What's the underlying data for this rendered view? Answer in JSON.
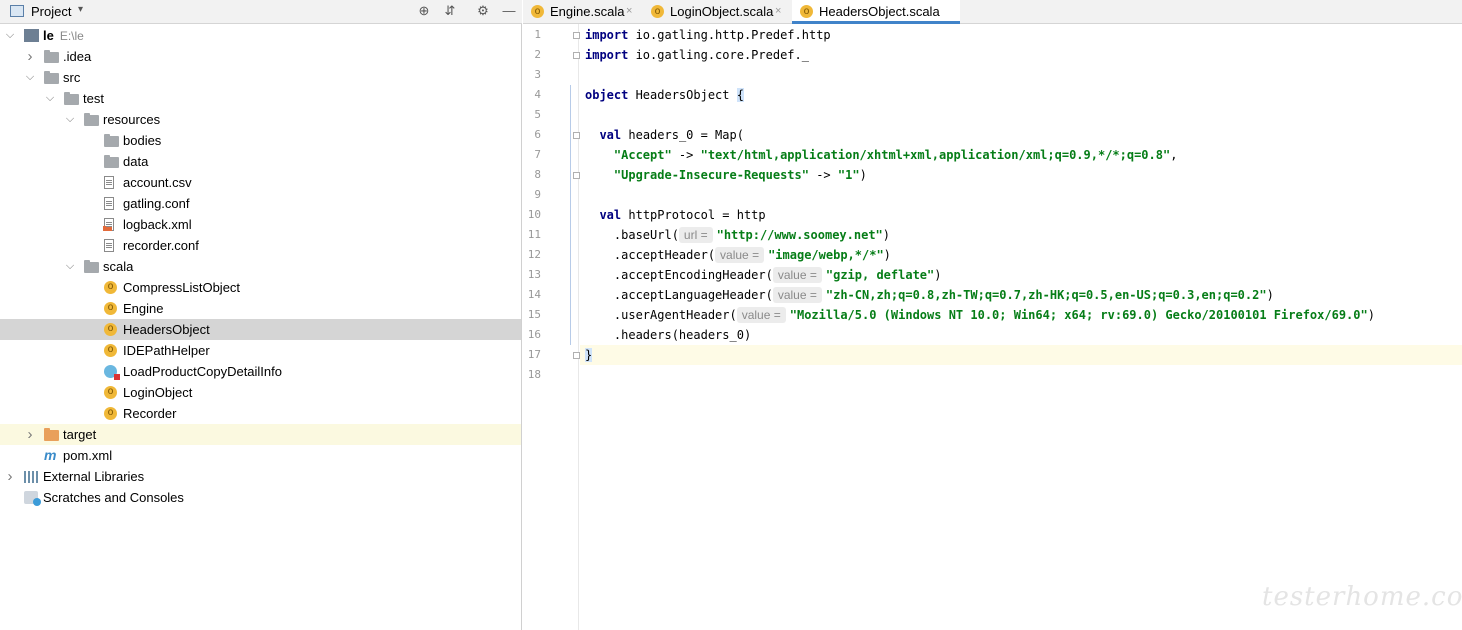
{
  "project_panel": {
    "title": "Project",
    "dropdown_arrow": "▾",
    "icons": [
      "project-panel-icon",
      "locate-icon",
      "collapse-all-icon",
      "settings-gear-icon",
      "hide-minimize-icon"
    ],
    "tree": [
      {
        "label": "le",
        "sublabel": "E:\\le",
        "icon": "module-folder-icon",
        "expanded": true,
        "depth": 0
      },
      {
        "label": ".idea",
        "icon": "folder-icon",
        "expanded": false,
        "depth": 1
      },
      {
        "label": "src",
        "icon": "folder-icon",
        "expanded": true,
        "depth": 1
      },
      {
        "label": "test",
        "icon": "folder-icon",
        "expanded": true,
        "depth": 2
      },
      {
        "label": "resources",
        "icon": "folder-icon",
        "expanded": true,
        "depth": 3
      },
      {
        "label": "bodies",
        "icon": "folder-icon",
        "depth": 4
      },
      {
        "label": "data",
        "icon": "folder-icon",
        "depth": 4
      },
      {
        "label": "account.csv",
        "icon": "text-file-icon",
        "depth": 4
      },
      {
        "label": "gatling.conf",
        "icon": "text-file-icon",
        "depth": 4
      },
      {
        "label": "logback.xml",
        "icon": "xml-file-icon",
        "depth": 4
      },
      {
        "label": "recorder.conf",
        "icon": "text-file-icon",
        "depth": 4
      },
      {
        "label": "scala",
        "icon": "folder-icon",
        "expanded": true,
        "depth": 3
      },
      {
        "label": "CompressListObject",
        "icon": "scala-object-icon",
        "depth": 4
      },
      {
        "label": "Engine",
        "icon": "scala-object-icon",
        "depth": 4
      },
      {
        "label": "HeadersObject",
        "icon": "scala-object-icon",
        "depth": 4,
        "selected": true
      },
      {
        "label": "IDEPathHelper",
        "icon": "scala-object-icon",
        "depth": 4
      },
      {
        "label": "LoadProductCopyDetailInfo",
        "icon": "scala-class-icon",
        "depth": 4
      },
      {
        "label": "LoginObject",
        "icon": "scala-object-icon",
        "depth": 4
      },
      {
        "label": "Recorder",
        "icon": "scala-object-icon",
        "depth": 4
      },
      {
        "label": "target",
        "icon": "excluded-folder-icon",
        "expanded": false,
        "depth": 1,
        "excluded": true
      },
      {
        "label": "pom.xml",
        "icon": "maven-icon",
        "depth": 1
      },
      {
        "label": "External Libraries",
        "icon": "libraries-icon",
        "expanded": false,
        "depth": 0
      },
      {
        "label": "Scratches and Consoles",
        "icon": "scratches-icon",
        "depth": 0
      }
    ]
  },
  "editor": {
    "tabs": [
      {
        "label": "Engine.scala",
        "close": "×",
        "active": false
      },
      {
        "label": "LoginObject.scala",
        "close": "×",
        "active": false
      },
      {
        "label": "HeadersObject.scala",
        "close": "×",
        "active": true
      }
    ],
    "line_numbers": [
      "1",
      "2",
      "3",
      "4",
      "5",
      "6",
      "7",
      "8",
      "9",
      "10",
      "11",
      "12",
      "13",
      "14",
      "15",
      "16",
      "17",
      "18"
    ],
    "current_line": 17,
    "lines": [
      [
        {
          "t": "import",
          "c": "kw"
        },
        {
          "t": " io.gatling.http.Predef.http"
        }
      ],
      [
        {
          "t": "import",
          "c": "kw"
        },
        {
          "t": " io.gatling.core.Predef._"
        }
      ],
      [],
      [
        {
          "t": "object",
          "c": "kw"
        },
        {
          "t": " HeadersObject "
        },
        {
          "t": "{",
          "c": "brace-hl"
        }
      ],
      [],
      [
        {
          "t": "  "
        },
        {
          "t": "val",
          "c": "kw"
        },
        {
          "t": " headers_0 = Map("
        }
      ],
      [
        {
          "t": "    "
        },
        {
          "t": "\"Accept\"",
          "c": "str"
        },
        {
          "t": " -> "
        },
        {
          "t": "\"text/html,application/xhtml+xml,application/xml;q=0.9,*/*;q=0.8\"",
          "c": "str"
        },
        {
          "t": ","
        }
      ],
      [
        {
          "t": "    "
        },
        {
          "t": "\"Upgrade-Insecure-Requests\"",
          "c": "str"
        },
        {
          "t": " -> "
        },
        {
          "t": "\"1\"",
          "c": "str"
        },
        {
          "t": ")"
        }
      ],
      [],
      [
        {
          "t": "  "
        },
        {
          "t": "val",
          "c": "kw"
        },
        {
          "t": " httpProtocol = http"
        }
      ],
      [
        {
          "t": "    .baseUrl("
        },
        {
          "t": "url =",
          "c": "hint"
        },
        {
          "t": "\"http://www.soomey.net\"",
          "c": "str"
        },
        {
          "t": ")"
        }
      ],
      [
        {
          "t": "    .acceptHeader("
        },
        {
          "t": "value =",
          "c": "hint"
        },
        {
          "t": "\"image/webp,*/*\"",
          "c": "str"
        },
        {
          "t": ")"
        }
      ],
      [
        {
          "t": "    .acceptEncodingHeader("
        },
        {
          "t": "value =",
          "c": "hint"
        },
        {
          "t": "\"gzip, deflate\"",
          "c": "str"
        },
        {
          "t": ")"
        }
      ],
      [
        {
          "t": "    .acceptLanguageHeader("
        },
        {
          "t": "value =",
          "c": "hint"
        },
        {
          "t": "\"zh-CN,zh;q=0.8,zh-TW;q=0.7,zh-HK;q=0.5,en-US;q=0.3,en;q=0.2\"",
          "c": "str"
        },
        {
          "t": ")"
        }
      ],
      [
        {
          "t": "    .userAgentHeader("
        },
        {
          "t": "value =",
          "c": "hint"
        },
        {
          "t": "\"Mozilla/5.0 (Windows NT 10.0; Win64; x64; rv:69.0) Gecko/20100101 Firefox/69.0\"",
          "c": "str"
        },
        {
          "t": ")"
        }
      ],
      [
        {
          "t": "    .headers(headers_0)"
        }
      ],
      [
        {
          "t": "}",
          "c": "brace-hl"
        }
      ],
      []
    ]
  },
  "watermark": "testerhome.com"
}
